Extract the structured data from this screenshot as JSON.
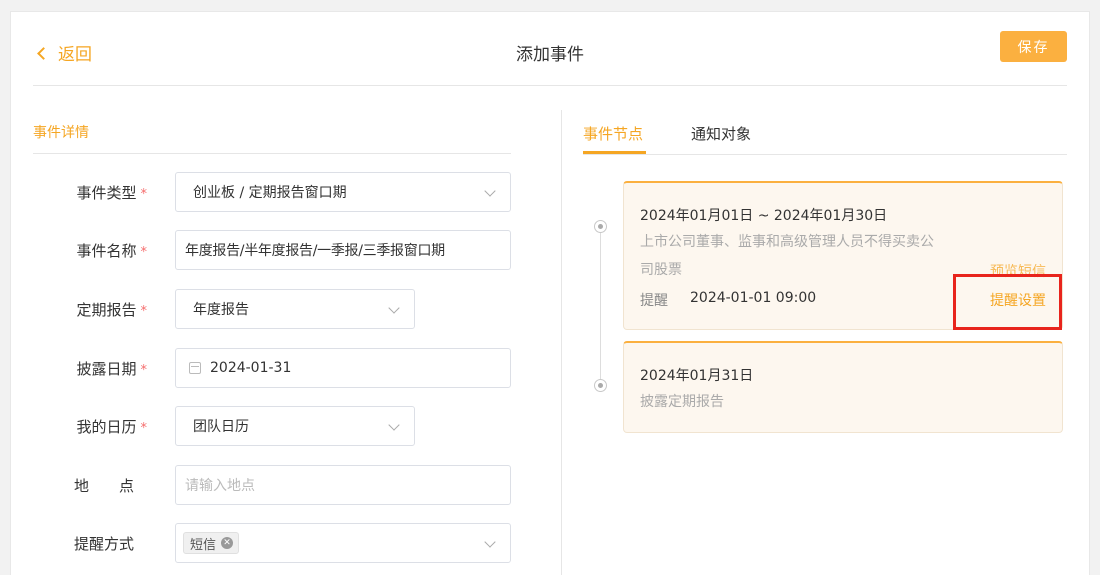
{
  "header": {
    "back_label": "返回",
    "title": "添加事件",
    "save_label": "保存"
  },
  "form": {
    "section_title": "事件详情",
    "fields": [
      {
        "label": "事件类型",
        "required": true,
        "value": "创业板 / 定期报告窗口期"
      },
      {
        "label": "事件名称",
        "required": true,
        "value": "年度报告/半年度报告/一季报/三季报窗口期"
      },
      {
        "label": "定期报告",
        "required": true,
        "value": "年度报告"
      },
      {
        "label": "披露日期",
        "required": true,
        "value": "2024-01-31"
      },
      {
        "label": "我的日历",
        "required": true,
        "value": "团队日历"
      },
      {
        "label": "地　　点",
        "required": false,
        "placeholder": "请输入地点"
      },
      {
        "label": "提醒方式",
        "required": false,
        "tag": "短信"
      }
    ],
    "required_mark": "*"
  },
  "tabs": [
    {
      "label": "事件节点",
      "active": true
    },
    {
      "label": "通知对象",
      "active": false
    }
  ],
  "nodes": [
    {
      "date": "2024年01月01日 ~ 2024年01月30日",
      "desc_line1": "上市公司董事、监事和高级管理人员不得买卖公",
      "desc_line2": "司股票",
      "preview_link": "预览短信",
      "remind_label": "提醒",
      "remind_time": "2024-01-01 09:00",
      "remind_link": "提醒设置"
    },
    {
      "date": "2024年01月31日",
      "desc": "披露定期报告"
    }
  ],
  "colors": {
    "accent": "#f5a623",
    "save_bg": "#fbb040",
    "required": "#f56c6c",
    "highlight": "#e8241c",
    "node_bg": "#fdf7ef"
  }
}
